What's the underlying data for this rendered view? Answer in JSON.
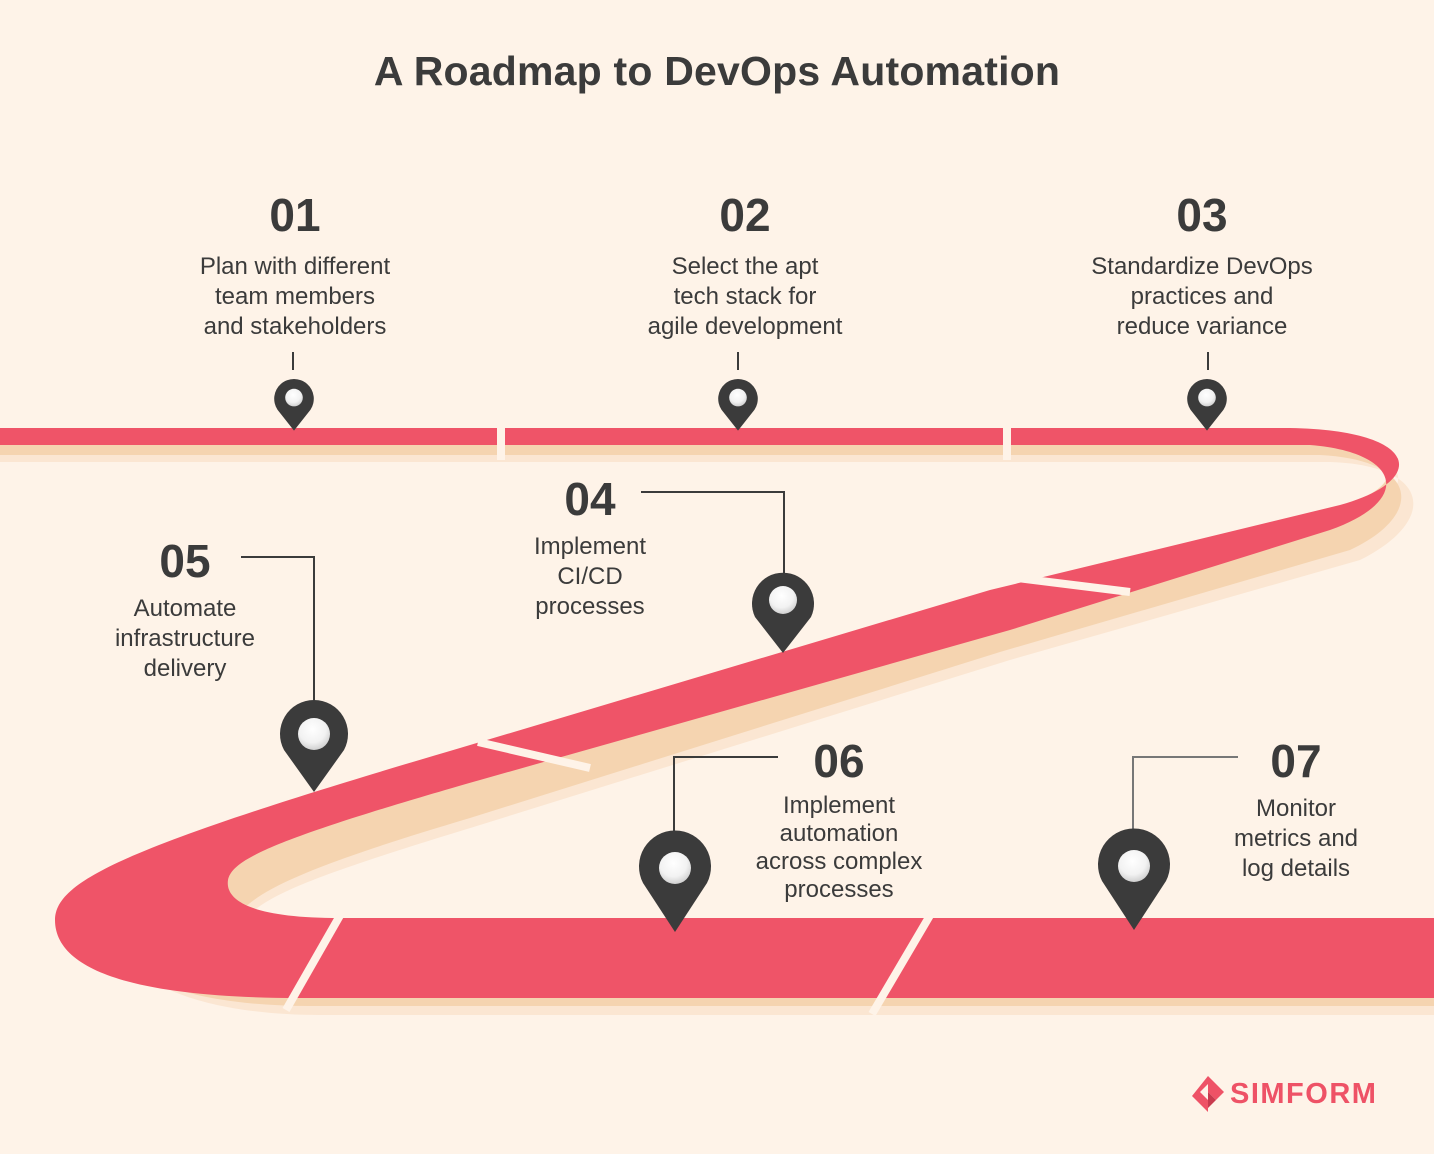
{
  "title": "A Roadmap to DevOps Automation",
  "colors": {
    "background": "#fef3e8",
    "road": "#ef5468",
    "road_shadow": "#f5d4b0",
    "road_shadow_light": "#fbe6d2",
    "pin": "#3b3b3b",
    "text": "#3b3b3b",
    "brand": "#ee5266"
  },
  "steps": [
    {
      "number": "01",
      "text": "Plan with different\nteam members\nand stakeholders"
    },
    {
      "number": "02",
      "text": "Select the apt\ntech stack for\nagile development"
    },
    {
      "number": "03",
      "text": "Standardize DevOps\npractices and\nreduce variance"
    },
    {
      "number": "04",
      "text": "Implement\nCI/CD\nprocesses"
    },
    {
      "number": "05",
      "text": "Automate\ninfrastructure\ndelivery"
    },
    {
      "number": "06",
      "text": "Implement\nautomation\nacross complex\nprocesses"
    },
    {
      "number": "07",
      "text": "Monitor\nmetrics and\nlog details"
    }
  ],
  "logo": {
    "icon": "simform-logo-icon",
    "text": "SIMFORM"
  }
}
